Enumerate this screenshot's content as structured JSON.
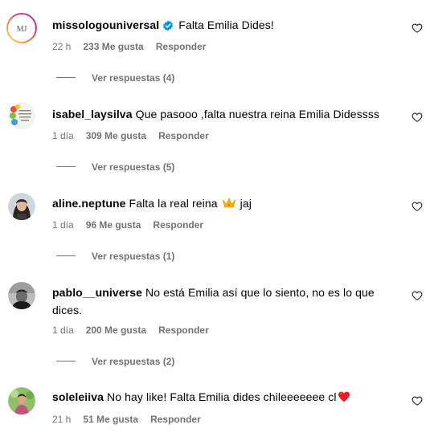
{
  "comments": [
    {
      "username": "missologouniversal",
      "verified": true,
      "text": "Falta Emilia Dides!",
      "time": "22 h",
      "likes": "233 Me gusta",
      "reply": "Responder",
      "view_replies": "Ver respuestas (4)",
      "avatar_text": "MJ"
    },
    {
      "username": "isabel_laysilva",
      "text": "Que pasooo ,falta nuestra reina Emilia Didessss",
      "time": "1 día",
      "likes": "309 Me gusta",
      "reply": "Responder",
      "view_replies": "Ver respuestas (5)"
    },
    {
      "username": "aline.neptune",
      "text_before": "Falta la real reina",
      "text_after": "jaj",
      "emoji": "crown",
      "time": "1 día",
      "likes": "96 Me gusta",
      "reply": "Responder",
      "view_replies": "Ver respuestas (1)"
    },
    {
      "username": "pablo__universe",
      "text": "No está Emilia así que lo siento, no es lo que dices.",
      "time": "1 día",
      "likes": "200 Me gusta",
      "reply": "Responder",
      "view_replies": "Ver respuestas (2)"
    },
    {
      "username": "soleleiiva",
      "text": "No hay like! Falta Emilia dides chileeeeeee cl",
      "emoji": "red-heart",
      "time": "21 h",
      "likes": "51 Me gusta",
      "reply": "Responder"
    }
  ],
  "colors": {
    "meta": "#737373",
    "verified": "#0095f6",
    "heart_emoji": "#ed1c24",
    "avatar_ring": "#d6249f"
  }
}
